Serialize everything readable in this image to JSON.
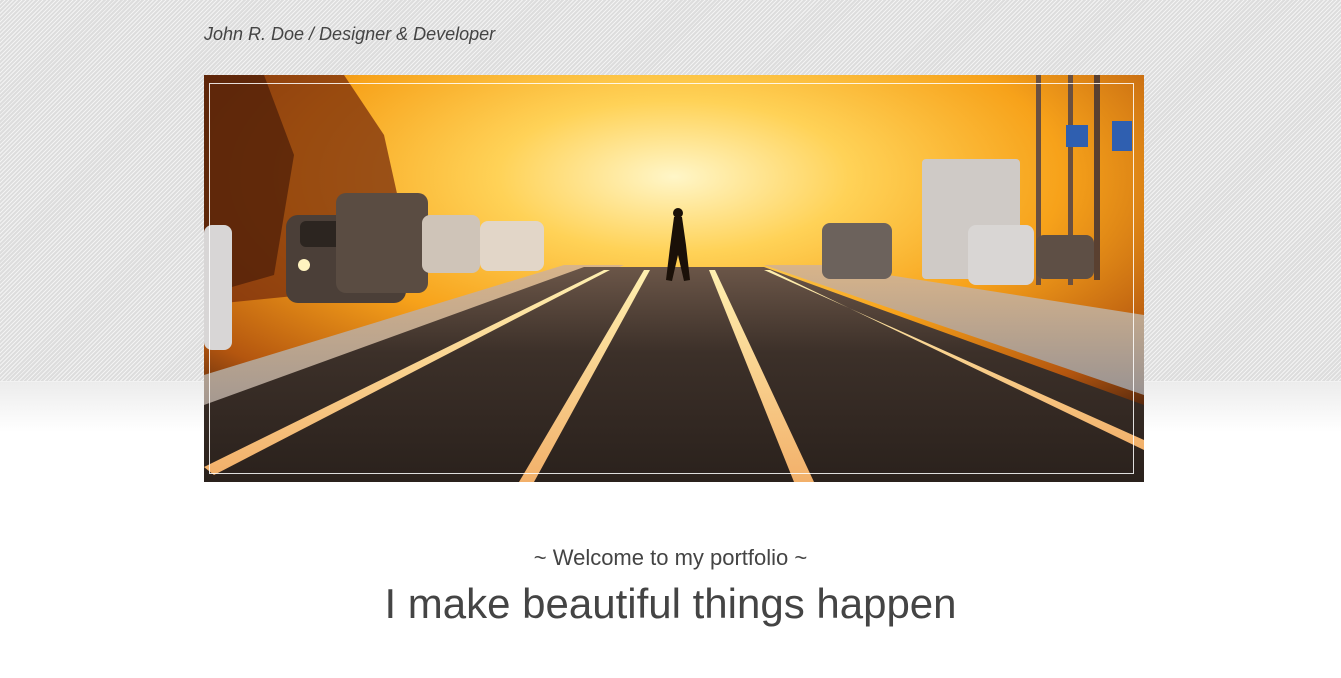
{
  "header": {
    "site_title": "John R. Doe / Designer & Developer"
  },
  "hero": {
    "image_subject": "city street at sunset with tram tracks and a pedestrian crossing"
  },
  "intro": {
    "tagline": "~ Welcome to my portfolio ~",
    "headline": "I make beautiful things happen"
  },
  "colors": {
    "text": "#444444",
    "band_background": "#e4e4e4",
    "sunset_glow": "#ffb42a"
  }
}
